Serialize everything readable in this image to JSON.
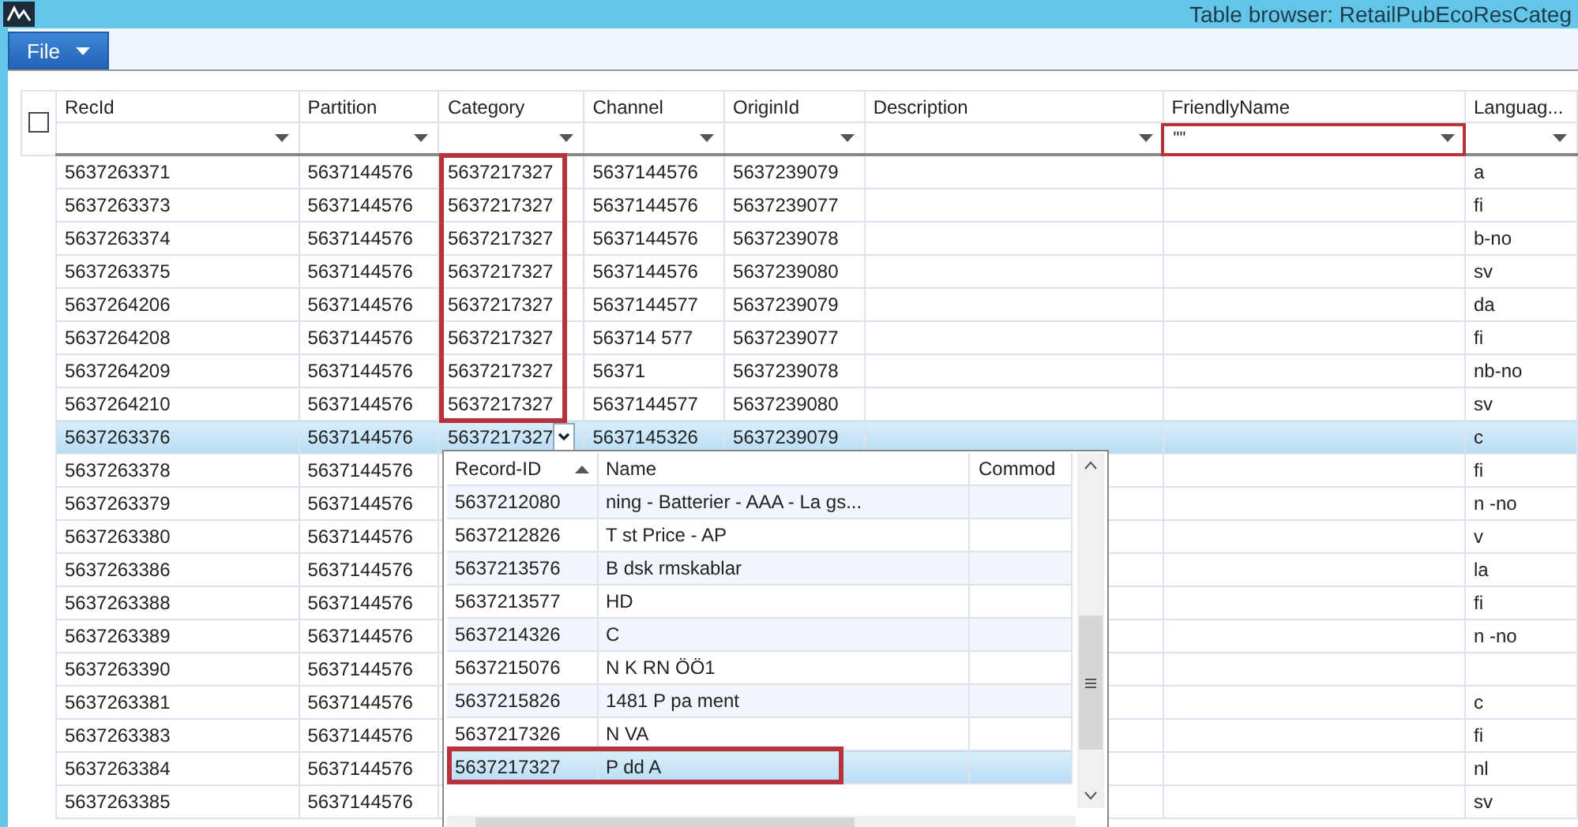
{
  "window": {
    "title": "Table browser: RetailPubEcoResCateg"
  },
  "menu": {
    "label": "File"
  },
  "grid": {
    "all_checked": false,
    "columns": [
      {
        "label": "RecId"
      },
      {
        "label": "Partition"
      },
      {
        "label": "Category"
      },
      {
        "label": "Channel"
      },
      {
        "label": "OriginId"
      },
      {
        "label": "Description"
      },
      {
        "label": "FriendlyName",
        "filter": "\"\""
      },
      {
        "label": "Languag..."
      }
    ],
    "rows": [
      {
        "cells": [
          "5637263371",
          "5637144576",
          "5637217327",
          "5637144576",
          "5637239079"
        ],
        "language": "a",
        "selected": false
      },
      {
        "cells": [
          "5637263373",
          "5637144576",
          "5637217327",
          "5637144576",
          "5637239077"
        ],
        "language": "fi",
        "selected": false
      },
      {
        "cells": [
          "5637263374",
          "5637144576",
          "5637217327",
          "5637144576",
          "5637239078"
        ],
        "language": "b-no",
        "selected": false
      },
      {
        "cells": [
          "5637263375",
          "5637144576",
          "5637217327",
          "5637144576",
          "5637239080"
        ],
        "language": "sv",
        "selected": false
      },
      {
        "cells": [
          "5637264206",
          "5637144576",
          "5637217327",
          "5637144577",
          "5637239079"
        ],
        "language": "da",
        "selected": false
      },
      {
        "cells": [
          "5637264208",
          "5637144576",
          "5637217327",
          "563714 577",
          "5637239077"
        ],
        "language": "fi",
        "selected": false
      },
      {
        "cells": [
          "5637264209",
          "5637144576",
          "5637217327",
          "56371",
          "5637239078"
        ],
        "language": "nb-no",
        "selected": false
      },
      {
        "cells": [
          "5637264210",
          "5637144576",
          "5637217327",
          "5637144577",
          "5637239080"
        ],
        "language": "sv",
        "selected": false
      },
      {
        "cells": [
          "5637263376",
          "5637144576",
          "5637217327",
          "5637145326",
          "5637239079"
        ],
        "language": "c",
        "selected": true
      },
      {
        "cells": [
          "5637263378",
          "5637144576"
        ],
        "language": "fi",
        "selected": false
      },
      {
        "cells": [
          "5637263379",
          "5637144576"
        ],
        "language": "n -no",
        "selected": false
      },
      {
        "cells": [
          "5637263380",
          "5637144576"
        ],
        "language": "v",
        "selected": false
      },
      {
        "cells": [
          "5637263386",
          "5637144576"
        ],
        "language": "la",
        "selected": false
      },
      {
        "cells": [
          "5637263388",
          "5637144576"
        ],
        "language": "fi",
        "selected": false
      },
      {
        "cells": [
          "5637263389",
          "5637144576"
        ],
        "language": "n -no",
        "selected": false
      },
      {
        "cells": [
          "5637263390",
          "5637144576"
        ],
        "selected": false
      },
      {
        "cells": [
          "5637263381",
          "5637144576"
        ],
        "language": "c",
        "selected": false
      },
      {
        "cells": [
          "5637263383",
          "5637144576"
        ],
        "language": "fi",
        "selected": false
      },
      {
        "cells": [
          "5637263384",
          "5637144576"
        ],
        "language": "nl",
        "selected": false
      },
      {
        "cells": [
          "5637263385",
          "5637144576"
        ],
        "language": "sv",
        "selected": false
      }
    ]
  },
  "lookup": {
    "columns": [
      {
        "label": "Record-ID",
        "sorted": true
      },
      {
        "label": "Name"
      },
      {
        "label": "Commod"
      }
    ],
    "rows": [
      {
        "record_id": "5637212080",
        "name": "ning - Batterier - AAA - La gs...",
        "selected": false
      },
      {
        "record_id": "5637212826",
        "name": "T st Price - AP",
        "selected": false
      },
      {
        "record_id": "5637213576",
        "name": "B dsk rmskablar",
        "selected": false
      },
      {
        "record_id": "5637213577",
        "name": "HD",
        "selected": false
      },
      {
        "record_id": "5637214326",
        "name": "C",
        "selected": false
      },
      {
        "record_id": "5637215076",
        "name": "N K RN ÖÖ1",
        "selected": false
      },
      {
        "record_id": "5637215826",
        "name": "1481 P pa ment",
        "selected": false
      },
      {
        "record_id": "5637217326",
        "name": "N VA",
        "selected": false
      },
      {
        "record_id": "5637217327",
        "name": "P dd A",
        "selected": true
      }
    ]
  }
}
